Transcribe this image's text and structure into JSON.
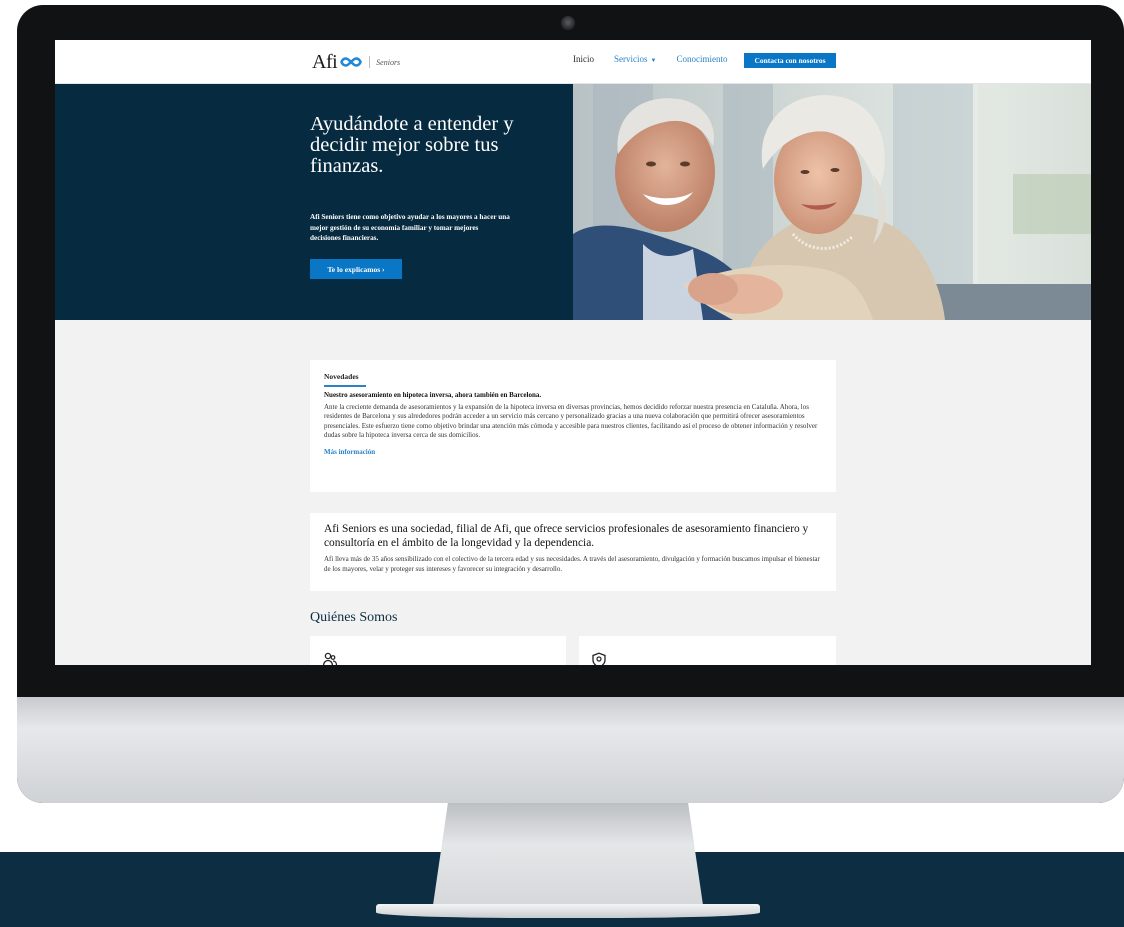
{
  "header": {
    "logo_text": "Afi",
    "logo_sub": "Seniors",
    "nav": {
      "inicio": "Inicio",
      "servicios": "Servicios",
      "conocimiento": "Conocimiento"
    },
    "contact_label": "Contacta con nosotros"
  },
  "hero": {
    "title": "Ayudándote a entender y decidir mejor sobre tus finanzas.",
    "text": "Afi Seniors tiene como objetivo ayudar a los mayores a hacer una mejor gestión de su economía familiar y tomar mejores decisiones financieras.",
    "cta_label": "Te lo explicamos ›"
  },
  "news": {
    "tag": "Novedades",
    "headline": "Nuestro asesoramiento en hipoteca inversa, ahora también en Barcelona.",
    "body": "Ante la creciente demanda de asesoramientos y la expansión de la hipoteca inversa en diversas provincias, hemos decidido reforzar nuestra presencia en Cataluña. Ahora, los residentes de Barcelona y sus alrededores podrán acceder a un servicio más cercano y personalizado gracias a una nueva colaboración que permitirá ofrecer asesoramientos presenciales. Este esfuerzo tiene como objetivo brindar una atención más cómoda y accesible para nuestros clientes, facilitando así el proceso de obtener información y resolver dudas sobre la hipoteca inversa cerca de sus domicilios.",
    "link_label": "Más información"
  },
  "about": {
    "title": "Afi Seniors es una sociedad, filial de Afi, que ofrece servicios profesionales de asesoramiento financiero y consultoría en el ámbito de la longevidad y la dependencia.",
    "body": "Afi lleva más de 35 años sensibilizado con el colectivo de la tercera edad y sus necesidades. A través del asesoramiento, divulgación y formación buscamos impulsar el bienestar de los mayores, velar y proteger sus intereses y favorecer su integración y desarrollo."
  },
  "section": {
    "title": "Quiénes Somos"
  },
  "icons": {
    "logo": "infinity-icon",
    "nav_caret": "chevron-down-icon",
    "card_1": "people-icon",
    "card_2": "location-shield-icon"
  },
  "colors": {
    "navy": "#062a40",
    "accent_blue": "#0a76c6",
    "link_blue": "#2a83c8",
    "page_background": "#f2f2f2",
    "band_navy": "#0d2d42"
  }
}
